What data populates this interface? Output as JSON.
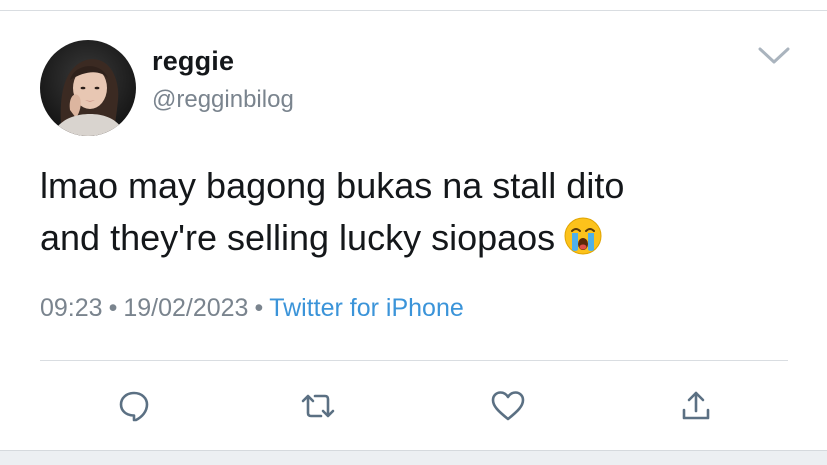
{
  "tweet": {
    "author": {
      "display_name": "reggie",
      "handle": "@regginbilog",
      "avatar": "profile-photo"
    },
    "text_lines": [
      "lmao may bagong bukas na stall dito",
      "and they're selling lucky siopaos"
    ],
    "emoji": "loudly-crying-face",
    "time": "09:23",
    "separator": "•",
    "date": "19/02/2023",
    "source": "Twitter for iPhone"
  },
  "actions": {
    "reply": "reply-icon",
    "retweet": "retweet-icon",
    "like": "heart-icon",
    "share": "share-icon"
  },
  "colors": {
    "text": "#14171a",
    "secondary": "#7a848e",
    "link": "#3b94d9",
    "action_icon": "#5b7083",
    "divider": "#d9dde1"
  }
}
